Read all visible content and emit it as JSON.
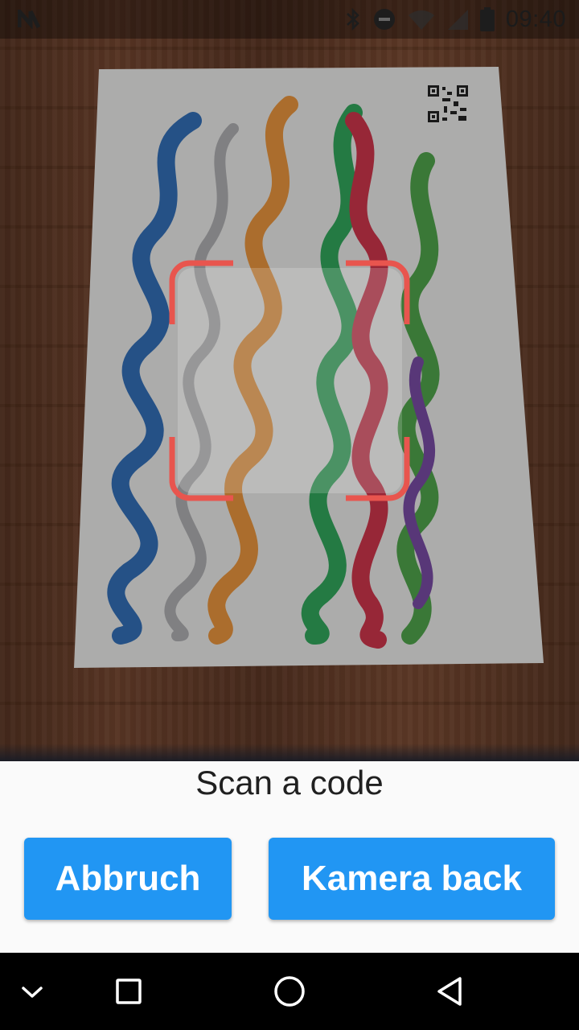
{
  "status_bar": {
    "time": "09:40",
    "icons": [
      "n-logo-icon",
      "bluetooth-icon",
      "do-not-disturb-icon",
      "wifi-icon",
      "signal-icon",
      "battery-icon"
    ]
  },
  "scanner": {
    "prompt": "Scan a code",
    "frame_color": "#e8554e"
  },
  "buttons": {
    "cancel_label": "Abbruch",
    "switch_camera_label": "Kamera back",
    "color": "#2196f3"
  },
  "nav_bar": {
    "icons": [
      "chevron-down-icon",
      "recents-square-icon",
      "home-circle-icon",
      "back-triangle-icon"
    ]
  }
}
